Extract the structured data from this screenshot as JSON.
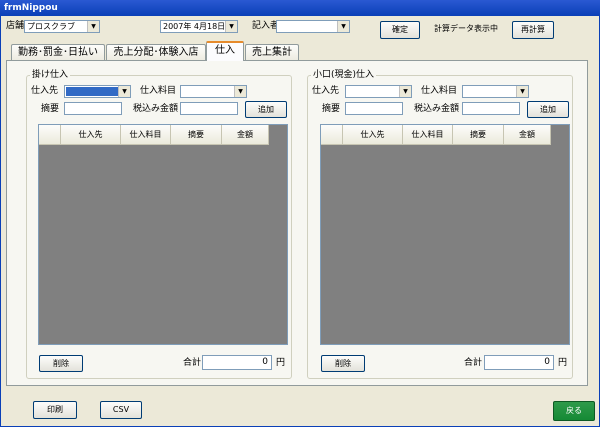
{
  "window": {
    "title": "frmNippou"
  },
  "header": {
    "store_label": "店舗",
    "store_value": "プロスクラブ",
    "date_value": "2007年  4月18日",
    "author_label": "記入者",
    "author_value": "",
    "confirm_button": "確定",
    "status_text": "計算データ表示中",
    "recalc_button": "再計算"
  },
  "tabs": [
    {
      "label": "勤務･罰金･日払い"
    },
    {
      "label": "売上分配･体験入店"
    },
    {
      "label": "仕入"
    },
    {
      "label": "売上集計"
    }
  ],
  "credit_panel": {
    "title": "掛け仕入",
    "supplier_label": "仕入先",
    "item_label": "仕入料目",
    "summary_label": "摘要",
    "amount_label": "税込み金額",
    "add_button": "追加",
    "columns": [
      "仕入先",
      "仕入料目",
      "摘要",
      "金額"
    ],
    "delete_button": "削除",
    "total_label": "合計",
    "total_value": "0",
    "yen": "円"
  },
  "cash_panel": {
    "title": "小口(現金)仕入",
    "supplier_label": "仕入先",
    "item_label": "仕入料目",
    "summary_label": "摘要",
    "amount_label": "税込み金額",
    "add_button": "追加",
    "columns": [
      "仕入先",
      "仕入料目",
      "摘要",
      "金額"
    ],
    "delete_button": "削除",
    "total_label": "合計",
    "total_value": "0",
    "yen": "円"
  },
  "footer": {
    "print_button": "印刷",
    "csv_button": "CSV",
    "back_button": "戻る"
  },
  "colors": {
    "titlebar": "#0a3fb7",
    "grid_bg": "#808080",
    "back_button": "#158a35",
    "active_tab": "#e68b2c"
  }
}
